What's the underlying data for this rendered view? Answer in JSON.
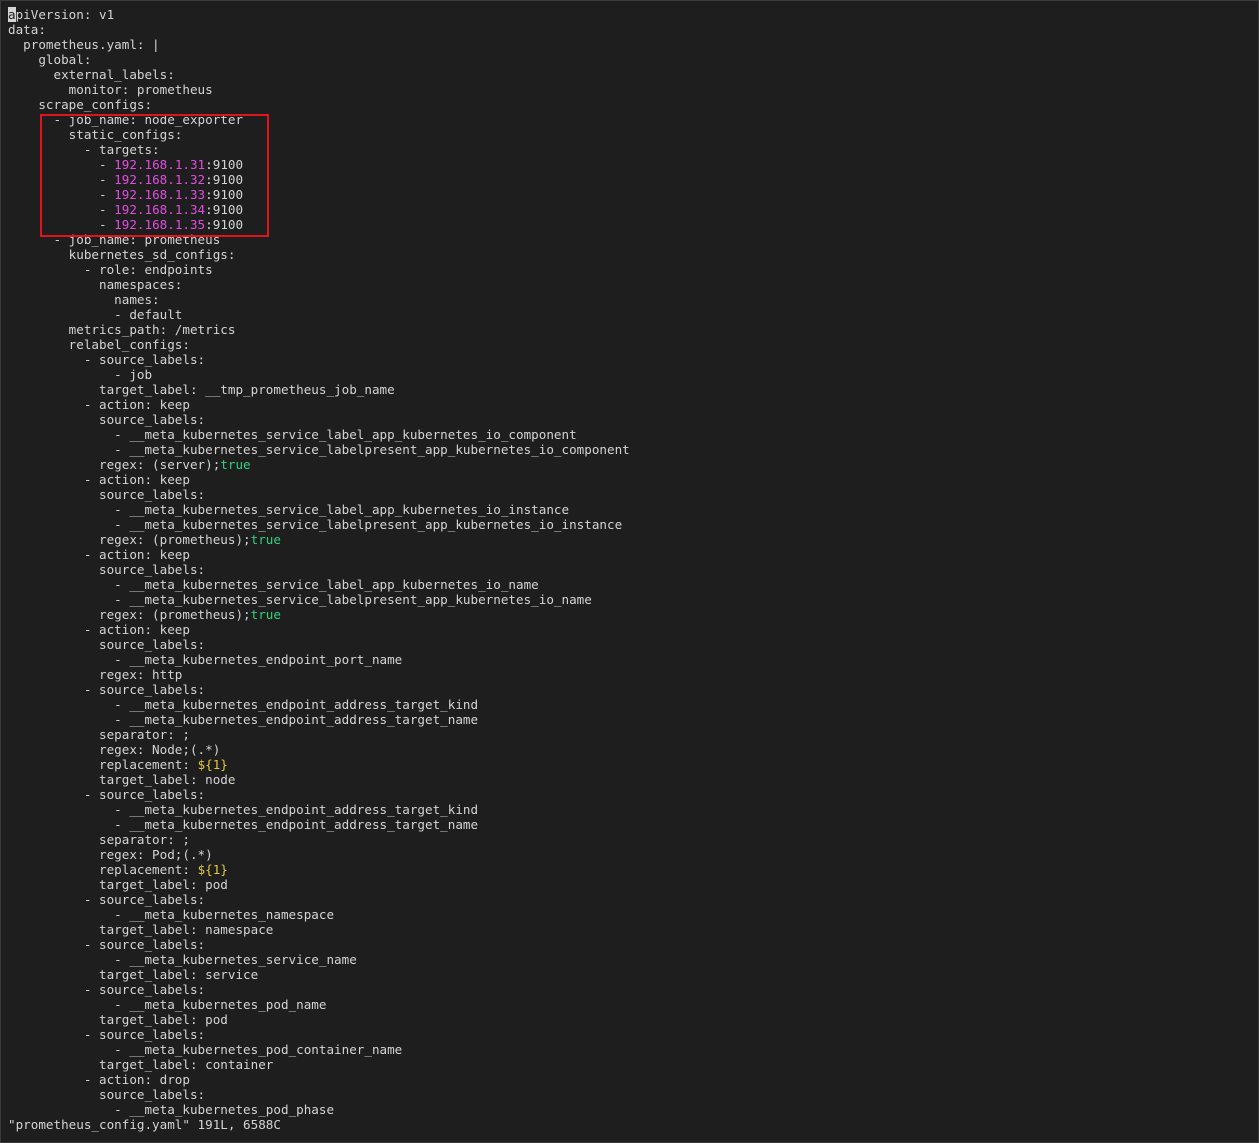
{
  "editor": {
    "lines": [
      [
        {
          "t": "a",
          "k": "cursor"
        },
        {
          "t": "piVersion: v1"
        }
      ],
      [
        {
          "t": "data:"
        }
      ],
      [
        {
          "t": "  prometheus.yaml: |"
        }
      ],
      [
        {
          "t": "    global:"
        }
      ],
      [
        {
          "t": "      external_labels:"
        }
      ],
      [
        {
          "t": "        monitor: prometheus"
        }
      ],
      [
        {
          "t": "    scrape_configs:"
        }
      ],
      [
        {
          "t": "      - job_name: node_exporter"
        }
      ],
      [
        {
          "t": "        static_configs:"
        }
      ],
      [
        {
          "t": "          - targets:"
        }
      ],
      [
        {
          "t": "            - "
        },
        {
          "t": "192.168.1.31",
          "k": "ip"
        },
        {
          "t": ":9100"
        }
      ],
      [
        {
          "t": "            - "
        },
        {
          "t": "192.168.1.32",
          "k": "ip"
        },
        {
          "t": ":9100"
        }
      ],
      [
        {
          "t": "            - "
        },
        {
          "t": "192.168.1.33",
          "k": "ip"
        },
        {
          "t": ":9100"
        }
      ],
      [
        {
          "t": "            - "
        },
        {
          "t": "192.168.1.34",
          "k": "ip"
        },
        {
          "t": ":9100"
        }
      ],
      [
        {
          "t": "            - "
        },
        {
          "t": "192.168.1.35",
          "k": "ip"
        },
        {
          "t": ":9100"
        }
      ],
      [
        {
          "t": "      - job_name: prometheus"
        }
      ],
      [
        {
          "t": "        kubernetes_sd_configs:"
        }
      ],
      [
        {
          "t": "          - role: endpoints"
        }
      ],
      [
        {
          "t": "            namespaces:"
        }
      ],
      [
        {
          "t": "              names:"
        }
      ],
      [
        {
          "t": "              - default"
        }
      ],
      [
        {
          "t": "        metrics_path: /metrics"
        }
      ],
      [
        {
          "t": "        relabel_configs:"
        }
      ],
      [
        {
          "t": "          - source_labels:"
        }
      ],
      [
        {
          "t": "              - job"
        }
      ],
      [
        {
          "t": "            target_label: __tmp_prometheus_job_name"
        }
      ],
      [
        {
          "t": "          - action: keep"
        }
      ],
      [
        {
          "t": "            source_labels:"
        }
      ],
      [
        {
          "t": "              - __meta_kubernetes_service_label_app_kubernetes_io_component"
        }
      ],
      [
        {
          "t": "              - __meta_kubernetes_service_labelpresent_app_kubernetes_io_component"
        }
      ],
      [
        {
          "t": "            regex: (server);"
        },
        {
          "t": "true",
          "k": "bool"
        }
      ],
      [
        {
          "t": "          - action: keep"
        }
      ],
      [
        {
          "t": "            source_labels:"
        }
      ],
      [
        {
          "t": "              - __meta_kubernetes_service_label_app_kubernetes_io_instance"
        }
      ],
      [
        {
          "t": "              - __meta_kubernetes_service_labelpresent_app_kubernetes_io_instance"
        }
      ],
      [
        {
          "t": "            regex: (prometheus);"
        },
        {
          "t": "true",
          "k": "bool"
        }
      ],
      [
        {
          "t": "          - action: keep"
        }
      ],
      [
        {
          "t": "            source_labels:"
        }
      ],
      [
        {
          "t": "              - __meta_kubernetes_service_label_app_kubernetes_io_name"
        }
      ],
      [
        {
          "t": "              - __meta_kubernetes_service_labelpresent_app_kubernetes_io_name"
        }
      ],
      [
        {
          "t": "            regex: (prometheus);"
        },
        {
          "t": "true",
          "k": "bool"
        }
      ],
      [
        {
          "t": "          - action: keep"
        }
      ],
      [
        {
          "t": "            source_labels:"
        }
      ],
      [
        {
          "t": "              - __meta_kubernetes_endpoint_port_name"
        }
      ],
      [
        {
          "t": "            regex: http"
        }
      ],
      [
        {
          "t": "          - source_labels:"
        }
      ],
      [
        {
          "t": "              - __meta_kubernetes_endpoint_address_target_kind"
        }
      ],
      [
        {
          "t": "              - __meta_kubernetes_endpoint_address_target_name"
        }
      ],
      [
        {
          "t": "            separator: ;"
        }
      ],
      [
        {
          "t": "            regex: Node;(.*)"
        }
      ],
      [
        {
          "t": "            replacement: "
        },
        {
          "t": "${1}",
          "k": "var"
        }
      ],
      [
        {
          "t": "            target_label: node"
        }
      ],
      [
        {
          "t": "          - source_labels:"
        }
      ],
      [
        {
          "t": "              - __meta_kubernetes_endpoint_address_target_kind"
        }
      ],
      [
        {
          "t": "              - __meta_kubernetes_endpoint_address_target_name"
        }
      ],
      [
        {
          "t": "            separator: ;"
        }
      ],
      [
        {
          "t": "            regex: Pod;(.*)"
        }
      ],
      [
        {
          "t": "            replacement: "
        },
        {
          "t": "${1}",
          "k": "var"
        }
      ],
      [
        {
          "t": "            target_label: pod"
        }
      ],
      [
        {
          "t": "          - source_labels:"
        }
      ],
      [
        {
          "t": "              - __meta_kubernetes_namespace"
        }
      ],
      [
        {
          "t": "            target_label: namespace"
        }
      ],
      [
        {
          "t": "          - source_labels:"
        }
      ],
      [
        {
          "t": "              - __meta_kubernetes_service_name"
        }
      ],
      [
        {
          "t": "            target_label: service"
        }
      ],
      [
        {
          "t": "          - source_labels:"
        }
      ],
      [
        {
          "t": "              - __meta_kubernetes_pod_name"
        }
      ],
      [
        {
          "t": "            target_label: pod"
        }
      ],
      [
        {
          "t": "          - source_labels:"
        }
      ],
      [
        {
          "t": "              - __meta_kubernetes_pod_container_name"
        }
      ],
      [
        {
          "t": "            target_label: container"
        }
      ],
      [
        {
          "t": "          - action: drop"
        }
      ],
      [
        {
          "t": "            source_labels:"
        }
      ],
      [
        {
          "t": "              - __meta_kubernetes_pod_phase"
        }
      ]
    ]
  },
  "status_line": "\"prometheus_config.yaml\" 191L, 6588C",
  "colors": {
    "background": "#1e1e1e",
    "text": "#d4d4d4",
    "ip_literal": "#e14de1",
    "boolean": "#2fd17b",
    "variable": "#e6c93a",
    "annotation_box": "#e0141e"
  }
}
